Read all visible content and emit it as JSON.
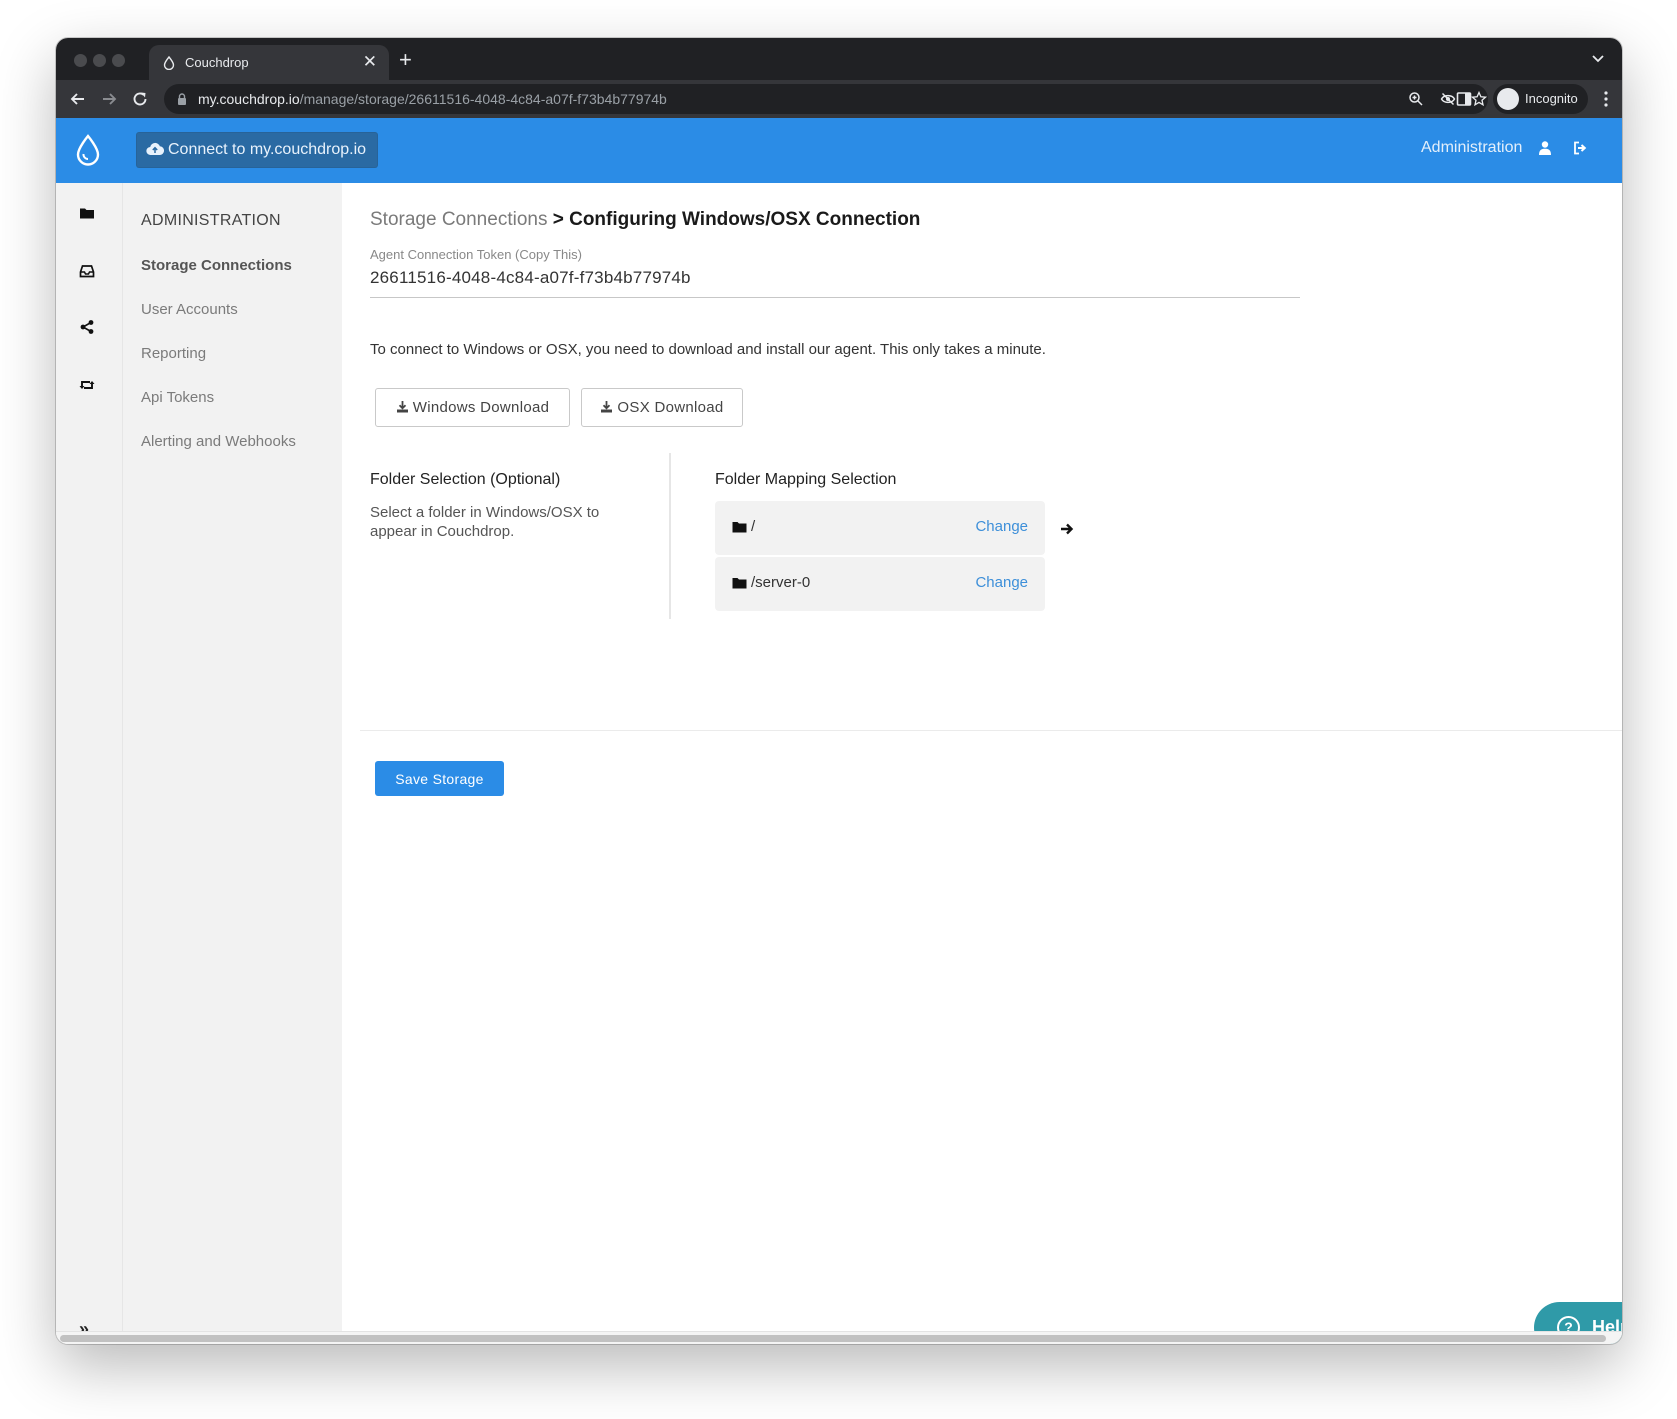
{
  "browser": {
    "tab_title": "Couchdrop",
    "tab_close": "✕",
    "new_tab": "+",
    "url_host": "my.couchdrop.io",
    "url_path": "/manage/storage/26611516-4048-4c84-a07f-f73b4b77974b",
    "incognito_label": "Incognito"
  },
  "header": {
    "connect_label": "Connect to my.couchdrop.io",
    "admin_link": "Administration",
    "accent_color": "#2b8ce6"
  },
  "rail": {
    "icons": [
      "folder-icon",
      "inbox-icon",
      "share-icon",
      "retweet-icon"
    ],
    "expand": "»"
  },
  "menu": {
    "title": "ADMINISTRATION",
    "items": [
      {
        "label": "Storage Connections",
        "active": true
      },
      {
        "label": "User Accounts",
        "active": false
      },
      {
        "label": "Reporting",
        "active": false
      },
      {
        "label": "Api Tokens",
        "active": false
      },
      {
        "label": "Alerting and Webhooks",
        "active": false
      }
    ]
  },
  "main": {
    "breadcrumb_parent": "Storage Connections",
    "breadcrumb_sep": " > ",
    "breadcrumb_current": "Configuring Windows/OSX Connection",
    "token_label": "Agent Connection Token (Copy This)",
    "token_value": "26611516-4048-4c84-a07f-f73b4b77974b",
    "intro_text": "To connect to Windows or OSX, you need to download and install our agent. This only takes a minute.",
    "windows_download": "Windows Download",
    "osx_download": "OSX Download",
    "folder_selection_title": "Folder Selection (Optional)",
    "folder_selection_desc": "Select a folder in Windows/OSX to appear in Couchdrop.",
    "folder_mapping_title": "Folder Mapping Selection",
    "mappings": [
      {
        "path": "/",
        "action": "Change"
      },
      {
        "path": "/server-0",
        "action": "Change"
      }
    ],
    "save_label": "Save Storage"
  },
  "help": {
    "label": "Help",
    "icon_glyph": "?",
    "color": "#2f9aa8"
  }
}
